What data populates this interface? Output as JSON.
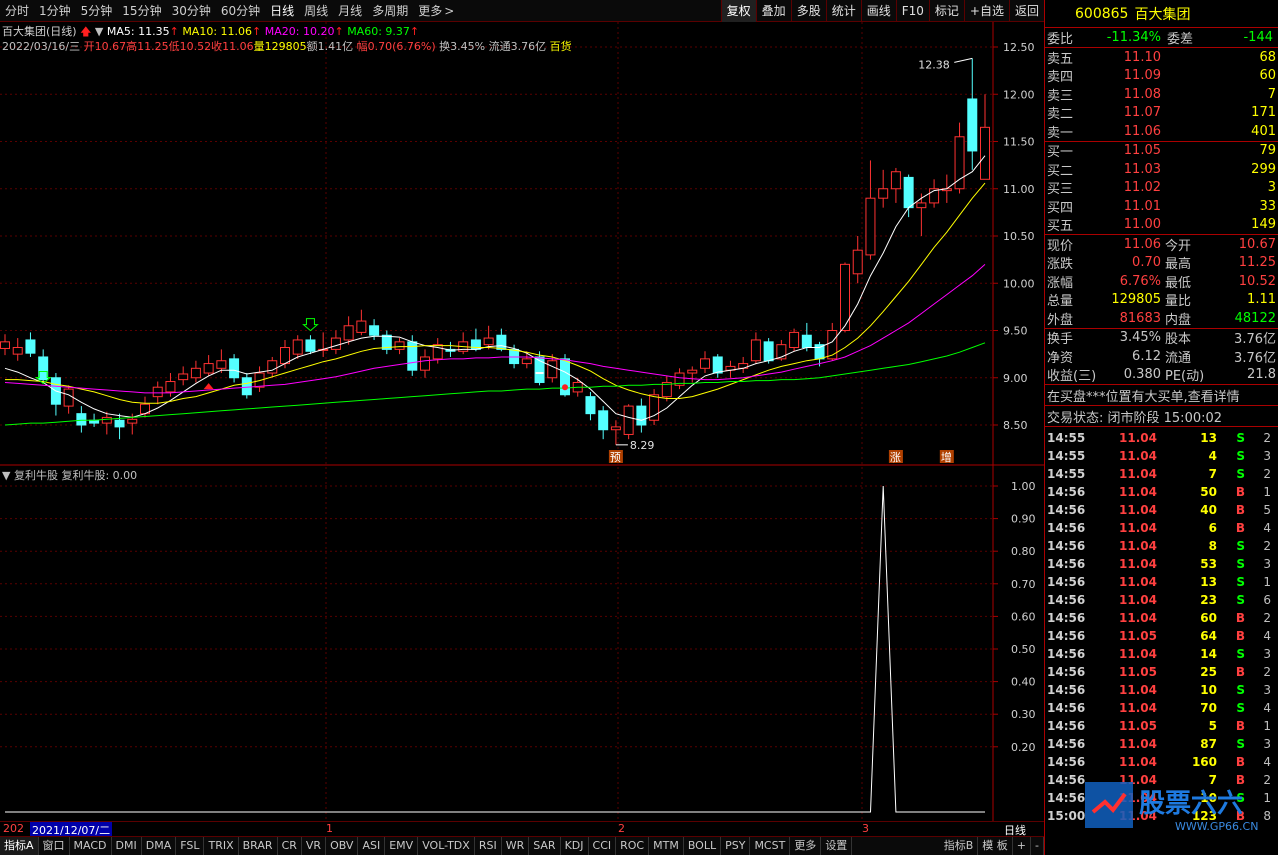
{
  "toolbar": {
    "periods": [
      "分时",
      "1分钟",
      "5分钟",
      "15分钟",
      "30分钟",
      "60分钟",
      "日线",
      "周线",
      "月线",
      "多周期",
      "更多"
    ],
    "active_period": "日线",
    "buttons": [
      "复权",
      "叠加",
      "多股",
      "统计",
      "画线",
      "F10",
      "标记",
      "+自选",
      "返回"
    ]
  },
  "chart": {
    "stock_label": "百大集团(日线)",
    "ma5": "MA5: 11.35",
    "ma10": "MA10: 11.06",
    "ma20": "MA20: 10.20",
    "ma60": "MA60: 9.37",
    "info_line": {
      "date": "2022/03/16/三",
      "open": "开10.67",
      "high": "高11.25",
      "low": "低10.52",
      "close": "收11.06",
      "volume": "量129805",
      "amount": "额1.41亿",
      "amplitude": "幅0.70(6.76%)",
      "turnover": "换3.45%",
      "float": "流通3.76亿",
      "industry": "百货"
    },
    "high_label": "12.38",
    "low_label": "8.29",
    "markers": [
      "预",
      "涨",
      "增"
    ],
    "price_axis": [
      "12.50",
      "12.00",
      "11.50",
      "11.00",
      "10.50",
      "10.00",
      "9.50",
      "9.00",
      "8.50"
    ],
    "indicator_title": "复利牛股",
    "indicator_value": "复利牛股: 0.00",
    "indicator_axis": [
      "1.00",
      "0.90",
      "0.80",
      "0.70",
      "0.60",
      "0.50",
      "0.40",
      "0.30",
      "0.20"
    ],
    "x_labels": [
      "202",
      "2021/12/07/二",
      "1",
      "2",
      "3"
    ],
    "x_axis_button": "日线",
    "colors": {
      "up": "#ff3232",
      "down": "#54ffff",
      "ma5": "#ffffff",
      "ma10": "#ffff00",
      "ma20": "#ff00ff",
      "ma60": "#00ff00"
    }
  },
  "tabs": [
    "指标A",
    "窗口",
    "MACD",
    "DMI",
    "DMA",
    "FSL",
    "TRIX",
    "BRAR",
    "CR",
    "VR",
    "OBV",
    "ASI",
    "EMV",
    "VOL-TDX",
    "RSI",
    "WR",
    "SAR",
    "KDJ",
    "CCI",
    "ROC",
    "MTM",
    "BOLL",
    "PSY",
    "MCST",
    "更多",
    "设置",
    "指标B",
    "模 板",
    "+",
    "-"
  ],
  "panel": {
    "code": "600865",
    "name": "百大集团",
    "weibi_label": "委比",
    "weibi": "-11.34%",
    "weicha_label": "委差",
    "weicha": "-144",
    "asks": [
      {
        "label": "卖五",
        "price": "11.10",
        "vol": "68"
      },
      {
        "label": "卖四",
        "price": "11.09",
        "vol": "60"
      },
      {
        "label": "卖三",
        "price": "11.08",
        "vol": "7"
      },
      {
        "label": "卖二",
        "price": "11.07",
        "vol": "171"
      },
      {
        "label": "卖一",
        "price": "11.06",
        "vol": "401"
      }
    ],
    "bids": [
      {
        "label": "买一",
        "price": "11.05",
        "vol": "79"
      },
      {
        "label": "买二",
        "price": "11.03",
        "vol": "299"
      },
      {
        "label": "买三",
        "price": "11.02",
        "vol": "3"
      },
      {
        "label": "买四",
        "price": "11.01",
        "vol": "33"
      },
      {
        "label": "买五",
        "price": "11.00",
        "vol": "149"
      }
    ],
    "quote": [
      {
        "l1": "现价",
        "v1": "11.06",
        "l2": "今开",
        "v2": "10.67"
      },
      {
        "l1": "涨跌",
        "v1": "0.70",
        "l2": "最高",
        "v2": "11.25"
      },
      {
        "l1": "涨幅",
        "v1": "6.76%",
        "l2": "最低",
        "v2": "10.52"
      },
      {
        "l1": "总量",
        "v1": "129805",
        "l2": "量比",
        "v2": "1.11"
      },
      {
        "l1": "外盘",
        "v1": "81683",
        "l2": "内盘",
        "v2": "48122"
      }
    ],
    "stats": [
      {
        "l1": "换手",
        "v1": "3.45%",
        "l2": "股本",
        "v2": "3.76亿"
      },
      {
        "l1": "净资",
        "v1": "6.12",
        "l2": "流通",
        "v2": "3.76亿"
      },
      {
        "l1": "收益(三)",
        "v1": "0.380",
        "l2": "PE(动)",
        "v2": "21.8"
      }
    ],
    "notice": "在买盘***位置有大买单,查看详情",
    "status": "交易状态: 闭市阶段 15:00:02",
    "ticks": [
      [
        "14:55",
        "11.04",
        "13",
        "S",
        "2"
      ],
      [
        "14:55",
        "11.04",
        "4",
        "S",
        "3"
      ],
      [
        "14:55",
        "11.04",
        "7",
        "S",
        "2"
      ],
      [
        "14:56",
        "11.04",
        "50",
        "B",
        "1"
      ],
      [
        "14:56",
        "11.04",
        "40",
        "B",
        "5"
      ],
      [
        "14:56",
        "11.04",
        "6",
        "B",
        "4"
      ],
      [
        "14:56",
        "11.04",
        "8",
        "S",
        "2"
      ],
      [
        "14:56",
        "11.04",
        "53",
        "S",
        "3"
      ],
      [
        "14:56",
        "11.04",
        "13",
        "S",
        "1"
      ],
      [
        "14:56",
        "11.04",
        "23",
        "S",
        "6"
      ],
      [
        "14:56",
        "11.04",
        "60",
        "B",
        "2"
      ],
      [
        "14:56",
        "11.05",
        "64",
        "B",
        "4"
      ],
      [
        "14:56",
        "11.04",
        "14",
        "S",
        "3"
      ],
      [
        "14:56",
        "11.05",
        "25",
        "B",
        "2"
      ],
      [
        "14:56",
        "11.04",
        "10",
        "S",
        "3"
      ],
      [
        "14:56",
        "11.04",
        "70",
        "S",
        "4"
      ],
      [
        "14:56",
        "11.05",
        "5",
        "B",
        "1"
      ],
      [
        "14:56",
        "11.04",
        "87",
        "S",
        "3"
      ],
      [
        "14:56",
        "11.04",
        "160",
        "B",
        "4"
      ],
      [
        "14:56",
        "11.04",
        "7",
        "B",
        "2"
      ],
      [
        "14:56",
        "11.04",
        "10",
        "S",
        "1"
      ],
      [
        "15:00",
        "11.04",
        "123",
        "B",
        "8"
      ]
    ],
    "watermark_text": "股票六六",
    "watermark_url": "WWW.GP66.CN"
  },
  "candles": [
    [
      9.31,
      9.38,
      9.46,
      9.24
    ],
    [
      9.25,
      9.32,
      9.42,
      9.18
    ],
    [
      9.4,
      9.26,
      9.48,
      9.22
    ],
    [
      9.22,
      8.98,
      9.3,
      8.95
    ],
    [
      9.0,
      8.72,
      9.05,
      8.6
    ],
    [
      8.7,
      8.88,
      8.92,
      8.62
    ],
    [
      8.62,
      8.5,
      8.7,
      8.42
    ],
    [
      8.55,
      8.52,
      8.62,
      8.48
    ],
    [
      8.52,
      8.58,
      8.64,
      8.4
    ],
    [
      8.55,
      8.48,
      8.62,
      8.35
    ],
    [
      8.52,
      8.56,
      8.62,
      8.4
    ],
    [
      8.62,
      8.72,
      8.8,
      8.58
    ],
    [
      8.8,
      8.9,
      8.96,
      8.72
    ],
    [
      8.85,
      8.96,
      9.05,
      8.8
    ],
    [
      8.98,
      9.04,
      9.12,
      8.92
    ],
    [
      9.0,
      9.1,
      9.18,
      8.95
    ],
    [
      9.05,
      9.15,
      9.24,
      9.02
    ],
    [
      9.1,
      9.18,
      9.3,
      9.05
    ],
    [
      9.2,
      9.0,
      9.25,
      8.95
    ],
    [
      9.0,
      8.82,
      9.05,
      8.78
    ],
    [
      8.9,
      9.05,
      9.12,
      8.85
    ],
    [
      9.05,
      9.18,
      9.22,
      9.0
    ],
    [
      9.15,
      9.32,
      9.4,
      9.1
    ],
    [
      9.25,
      9.4,
      9.45,
      9.2
    ],
    [
      9.4,
      9.28,
      9.45,
      9.25
    ],
    [
      9.3,
      9.3,
      9.48,
      9.22
    ],
    [
      9.3,
      9.42,
      9.5,
      9.25
    ],
    [
      9.4,
      9.55,
      9.65,
      9.35
    ],
    [
      9.48,
      9.6,
      9.72,
      9.45
    ],
    [
      9.55,
      9.45,
      9.62,
      9.4
    ],
    [
      9.45,
      9.3,
      9.5,
      9.25
    ],
    [
      9.3,
      9.38,
      9.42,
      9.25
    ],
    [
      9.38,
      9.08,
      9.45,
      9.02
    ],
    [
      9.08,
      9.22,
      9.3,
      9.0
    ],
    [
      9.2,
      9.35,
      9.42,
      9.15
    ],
    [
      9.3,
      9.28,
      9.38,
      9.22
    ],
    [
      9.28,
      9.38,
      9.48,
      9.25
    ],
    [
      9.4,
      9.3,
      9.52,
      9.28
    ],
    [
      9.35,
      9.42,
      9.55,
      9.3
    ],
    [
      9.45,
      9.3,
      9.52,
      9.28
    ],
    [
      9.3,
      9.15,
      9.35,
      9.1
    ],
    [
      9.15,
      9.2,
      9.28,
      9.1
    ],
    [
      9.22,
      8.95,
      9.28,
      8.92
    ],
    [
      9.0,
      9.18,
      9.25,
      8.95
    ],
    [
      9.2,
      8.82,
      9.25,
      8.8
    ],
    [
      8.85,
      8.95,
      9.0,
      8.8
    ],
    [
      8.8,
      8.62,
      8.85,
      8.55
    ],
    [
      8.65,
      8.45,
      8.7,
      8.35
    ],
    [
      8.45,
      8.48,
      8.55,
      8.29
    ],
    [
      8.4,
      8.7,
      8.72,
      8.35
    ],
    [
      8.7,
      8.5,
      8.78,
      8.42
    ],
    [
      8.55,
      8.82,
      8.88,
      8.5
    ],
    [
      8.8,
      8.95,
      9.02,
      8.75
    ],
    [
      8.92,
      9.05,
      9.1,
      8.88
    ],
    [
      9.05,
      9.08,
      9.12,
      8.95
    ],
    [
      9.1,
      9.2,
      9.28,
      9.05
    ],
    [
      9.22,
      9.05,
      9.25,
      9.0
    ],
    [
      9.08,
      9.12,
      9.18,
      9.0
    ],
    [
      9.1,
      9.15,
      9.22,
      9.05
    ],
    [
      9.18,
      9.4,
      9.48,
      9.15
    ],
    [
      9.38,
      9.18,
      9.42,
      9.15
    ],
    [
      9.2,
      9.35,
      9.4,
      9.18
    ],
    [
      9.32,
      9.48,
      9.52,
      9.28
    ],
    [
      9.45,
      9.32,
      9.58,
      9.28
    ],
    [
      9.35,
      9.2,
      9.38,
      9.12
    ],
    [
      9.2,
      9.5,
      9.58,
      9.18
    ],
    [
      9.5,
      10.2,
      10.22,
      9.48
    ],
    [
      10.1,
      10.35,
      10.5,
      10.0
    ],
    [
      10.3,
      10.9,
      11.3,
      10.25
    ],
    [
      10.9,
      11.0,
      11.2,
      10.8
    ],
    [
      11.0,
      11.18,
      11.22,
      10.85
    ],
    [
      11.12,
      10.8,
      11.15,
      10.7
    ],
    [
      10.8,
      10.85,
      10.95,
      10.5
    ],
    [
      10.85,
      11.0,
      11.1,
      10.8
    ],
    [
      10.98,
      11.0,
      11.15,
      10.85
    ],
    [
      11.0,
      11.55,
      11.7,
      10.95
    ],
    [
      11.95,
      11.4,
      12.38,
      11.2
    ],
    [
      11.1,
      11.65,
      12.0,
      11.1
    ]
  ],
  "ma_series": {
    "ma5": [
      9.1,
      9.06,
      9.0,
      8.95,
      8.86,
      8.82,
      8.74,
      8.67,
      8.62,
      8.6,
      8.58,
      8.62,
      8.68,
      8.76,
      8.85,
      8.94,
      9.02,
      9.08,
      9.08,
      9.04,
      9.06,
      9.08,
      9.15,
      9.22,
      9.26,
      9.3,
      9.34,
      9.38,
      9.42,
      9.44,
      9.44,
      9.43,
      9.38,
      9.34,
      9.32,
      9.29,
      9.3,
      9.3,
      9.33,
      9.34,
      9.31,
      9.26,
      9.18,
      9.12,
      9.06,
      8.98,
      8.88,
      8.75,
      8.62,
      8.58,
      8.55,
      8.6,
      8.68,
      8.8,
      8.92,
      9.02,
      9.06,
      9.08,
      9.1,
      9.15,
      9.18,
      9.22,
      9.28,
      9.32,
      9.32,
      9.38,
      9.55,
      9.78,
      10.08,
      10.32,
      10.6,
      10.8,
      10.9,
      10.98,
      11.0,
      11.1,
      11.18,
      11.35
    ],
    "ma10": [
      8.98,
      8.98,
      8.97,
      8.96,
      8.93,
      8.91,
      8.88,
      8.85,
      8.81,
      8.77,
      8.74,
      8.73,
      8.73,
      8.75,
      8.78,
      8.8,
      8.84,
      8.88,
      8.92,
      8.94,
      8.97,
      9.01,
      9.05,
      9.09,
      9.13,
      9.17,
      9.2,
      9.24,
      9.28,
      9.31,
      9.32,
      9.33,
      9.33,
      9.34,
      9.34,
      9.34,
      9.33,
      9.32,
      9.32,
      9.31,
      9.29,
      9.27,
      9.24,
      9.22,
      9.18,
      9.13,
      9.07,
      8.99,
      8.92,
      8.87,
      8.83,
      8.8,
      8.78,
      8.78,
      8.8,
      8.84,
      8.88,
      8.93,
      8.98,
      9.03,
      9.08,
      9.12,
      9.15,
      9.18,
      9.2,
      9.24,
      9.32,
      9.42,
      9.55,
      9.7,
      9.86,
      10.02,
      10.2,
      10.38,
      10.54,
      10.72,
      10.9,
      11.06
    ],
    "ma20": [
      8.95,
      8.94,
      8.93,
      8.92,
      8.91,
      8.9,
      8.89,
      8.88,
      8.87,
      8.86,
      8.85,
      8.84,
      8.84,
      8.84,
      8.85,
      8.86,
      8.87,
      8.88,
      8.89,
      8.9,
      8.91,
      8.92,
      8.93,
      8.95,
      8.97,
      8.99,
      9.01,
      9.04,
      9.07,
      9.1,
      9.12,
      9.14,
      9.16,
      9.18,
      9.19,
      9.2,
      9.2,
      9.21,
      9.21,
      9.22,
      9.22,
      9.22,
      9.21,
      9.2,
      9.19,
      9.17,
      9.15,
      9.12,
      9.1,
      9.08,
      9.06,
      9.04,
      9.02,
      9.0,
      8.99,
      8.98,
      8.98,
      8.99,
      9.0,
      9.02,
      9.04,
      9.06,
      9.09,
      9.12,
      9.15,
      9.18,
      9.22,
      9.28,
      9.34,
      9.42,
      9.5,
      9.58,
      9.68,
      9.78,
      9.88,
      9.98,
      10.08,
      10.2
    ],
    "ma60": [
      8.5,
      8.51,
      8.52,
      8.52,
      8.53,
      8.54,
      8.55,
      8.55,
      8.56,
      8.57,
      8.58,
      8.59,
      8.6,
      8.61,
      8.62,
      8.63,
      8.64,
      8.65,
      8.66,
      8.67,
      8.68,
      8.69,
      8.7,
      8.71,
      8.72,
      8.73,
      8.74,
      8.75,
      8.76,
      8.77,
      8.78,
      8.79,
      8.8,
      8.81,
      8.82,
      8.83,
      8.84,
      8.85,
      8.86,
      8.86,
      8.87,
      8.88,
      8.88,
      8.89,
      8.89,
      8.9,
      8.9,
      8.91,
      8.91,
      8.92,
      8.92,
      8.93,
      8.93,
      8.94,
      8.94,
      8.95,
      8.95,
      8.96,
      8.96,
      8.97,
      8.97,
      8.98,
      8.98,
      8.99,
      9.0,
      9.02,
      9.04,
      9.06,
      9.08,
      9.1,
      9.12,
      9.14,
      9.17,
      9.2,
      9.23,
      9.27,
      9.32,
      9.37
    ]
  },
  "indicator_series": [
    0,
    0,
    0,
    0,
    0,
    0,
    0,
    0,
    0,
    0,
    0,
    0,
    0,
    0,
    0,
    0,
    0,
    0,
    0,
    0,
    0,
    0,
    0,
    0,
    0,
    0,
    0,
    0,
    0,
    0,
    0,
    0,
    0,
    0,
    0,
    0,
    0,
    0,
    0,
    0,
    0,
    0,
    0,
    0,
    0,
    0,
    0,
    0,
    0,
    0,
    0,
    0,
    0,
    0,
    0,
    0,
    0,
    0,
    0,
    0,
    0,
    0,
    0,
    0,
    0,
    0,
    0,
    0,
    0,
    1,
    0,
    0,
    0,
    0,
    0,
    0,
    0,
    0
  ]
}
